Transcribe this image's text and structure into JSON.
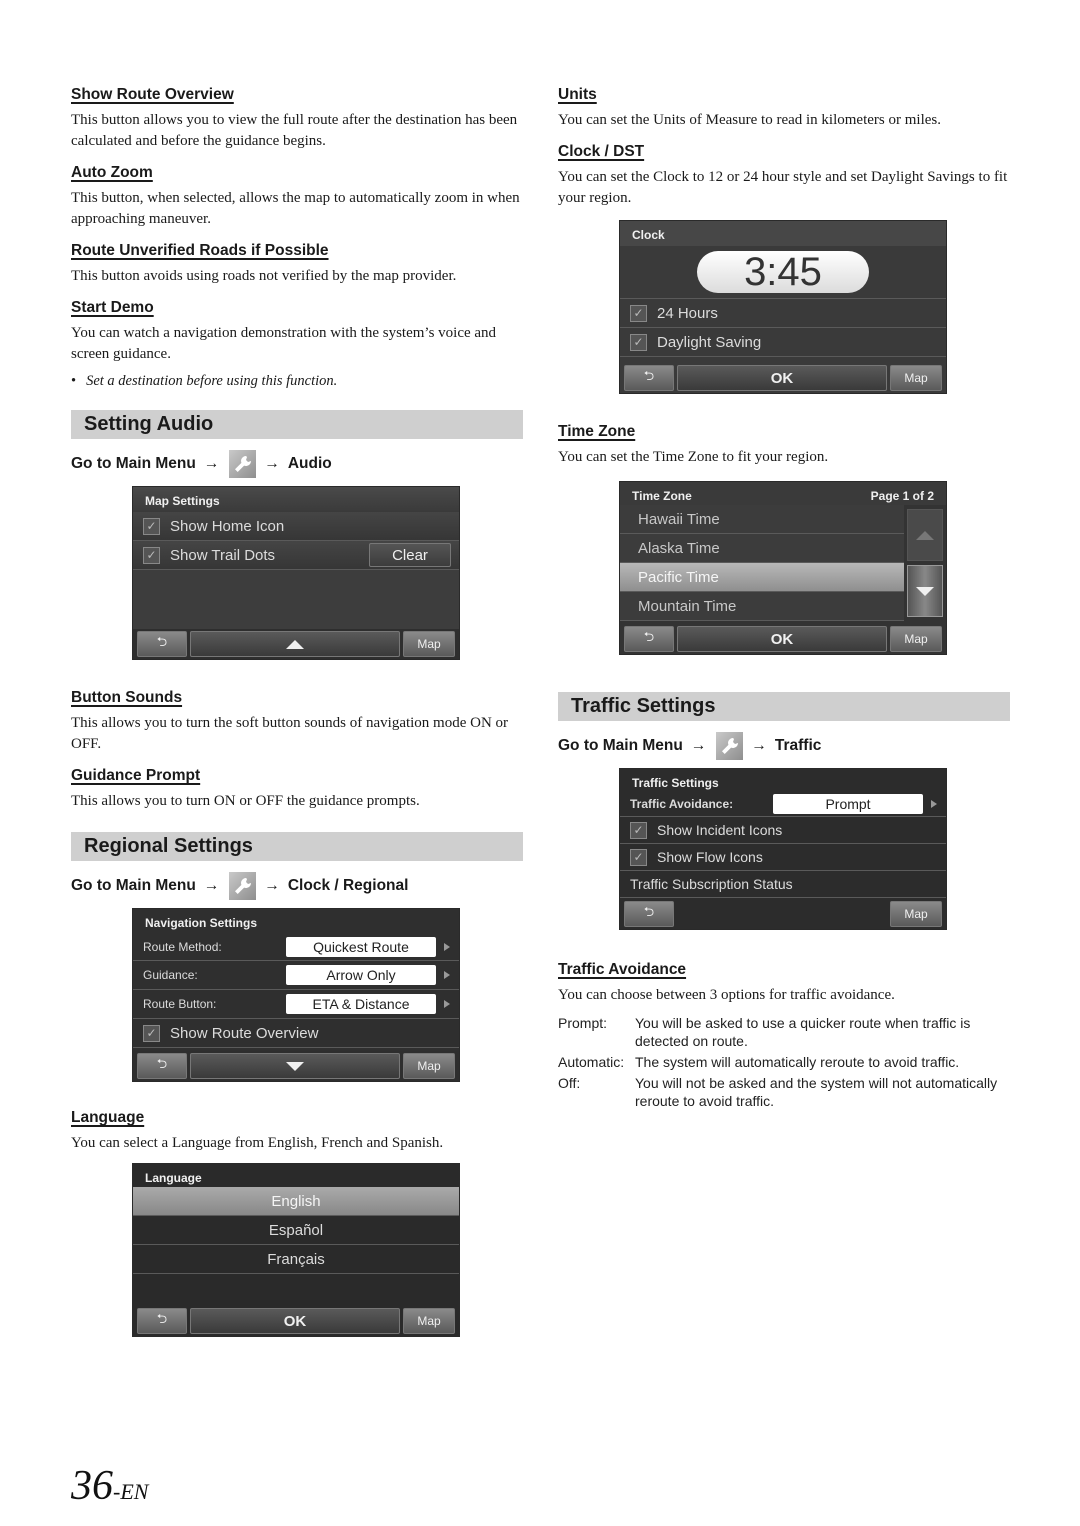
{
  "left": {
    "show_route_overview": {
      "heading": "Show Route Overview",
      "body": "This button allows you to view the full route after the destination has been calculated and before the guidance begins."
    },
    "auto_zoom": {
      "heading": "Auto Zoom",
      "body": "This button, when selected, allows the map to automatically zoom in when approaching maneuver."
    },
    "route_unverified": {
      "heading": "Route Unverified Roads if Possible",
      "body": "This button avoids using roads not verified by the map provider."
    },
    "start_demo": {
      "heading": "Start Demo",
      "body": "You can watch a navigation demonstration with the system’s voice and screen guidance.",
      "note_bullet": "•",
      "note": "Set a destination before using this function."
    },
    "setting_audio": {
      "title": "Setting Audio",
      "goto_prefix": "Go to Main Menu",
      "arrow": "→",
      "goto_target": "Audio",
      "screen": {
        "title": "Map Settings",
        "rows": [
          {
            "label": "Show Home Icon",
            "checked": true
          },
          {
            "label": "Show Trail Dots",
            "checked": true,
            "button": "Clear"
          }
        ],
        "back_label": "⮌",
        "map_label": "Map"
      }
    },
    "button_sounds": {
      "heading": "Button Sounds",
      "body": "This allows you to turn the soft button sounds of navigation mode ON or OFF."
    },
    "guidance_prompt": {
      "heading": "Guidance Prompt",
      "body": "This allows you to turn ON or OFF the guidance prompts."
    },
    "regional_settings": {
      "title": "Regional Settings",
      "goto_prefix": "Go to Main Menu",
      "arrow": "→",
      "goto_target": "Clock / Regional",
      "screen": {
        "title": "Navigation Settings",
        "rows": [
          {
            "label": "Route Method:",
            "value": "Quickest Route"
          },
          {
            "label": "Guidance:",
            "value": "Arrow Only"
          },
          {
            "label": "Route Button:",
            "value": "ETA & Distance"
          }
        ],
        "check_row": {
          "label": "Show Route Overview",
          "checked": true
        },
        "map_label": "Map"
      }
    },
    "language": {
      "heading": "Language",
      "body": "You can select a Language from English, French and Spanish.",
      "screen": {
        "title": "Language",
        "options": [
          "English",
          "Español",
          "Français"
        ],
        "selected": "English",
        "ok_label": "OK",
        "map_label": "Map"
      }
    }
  },
  "right": {
    "units": {
      "heading": "Units",
      "body": "You can set the Units of Measure to read in kilometers or miles."
    },
    "clock_dst": {
      "heading": "Clock / DST",
      "body": "You can set the Clock to 12 or 24 hour style and set Daylight Savings to fit your region.",
      "screen": {
        "title": "Clock",
        "time": "3:45",
        "rows": [
          {
            "label": "24 Hours",
            "checked": true
          },
          {
            "label": "Daylight Saving",
            "checked": true
          }
        ],
        "ok_label": "OK",
        "map_label": "Map"
      }
    },
    "time_zone": {
      "heading": "Time Zone",
      "body": "You can set the Time Zone to fit your region.",
      "screen": {
        "title": "Time Zone",
        "page": "Page 1 of 2",
        "options": [
          "Hawaii Time",
          "Alaska Time",
          "Pacific Time",
          "Mountain Time"
        ],
        "selected": "Pacific Time",
        "ok_label": "OK",
        "map_label": "Map"
      }
    },
    "traffic_settings": {
      "title": "Traffic Settings",
      "goto_prefix": "Go to Main Menu",
      "arrow": "→",
      "goto_target": "Traffic",
      "screen": {
        "title": "Traffic Settings",
        "avoidance_label": "Traffic Avoidance:",
        "avoidance_value": "Prompt",
        "rows": [
          {
            "label": "Show Incident Icons",
            "checked": true
          },
          {
            "label": "Show Flow Icons",
            "checked": true
          }
        ],
        "subscription_label": "Traffic Subscription Status",
        "map_label": "Map"
      }
    },
    "traffic_avoidance": {
      "heading": "Traffic Avoidance",
      "body": "You can choose between 3 options for traffic avoidance.",
      "options": [
        {
          "term": "Prompt:",
          "desc": "You will be asked to use a quicker route when traffic is detected on route."
        },
        {
          "term": "Automatic:",
          "desc": "The system will automatically reroute to avoid traffic."
        },
        {
          "term": "Off:",
          "desc": "You will not be asked and the system will not automatically reroute to avoid traffic."
        }
      ]
    }
  },
  "footer": {
    "page_number": "36",
    "page_suffix": "-EN"
  },
  "icons": {
    "check": "✓",
    "wrench": "wrench-icon",
    "back": "⮌"
  }
}
